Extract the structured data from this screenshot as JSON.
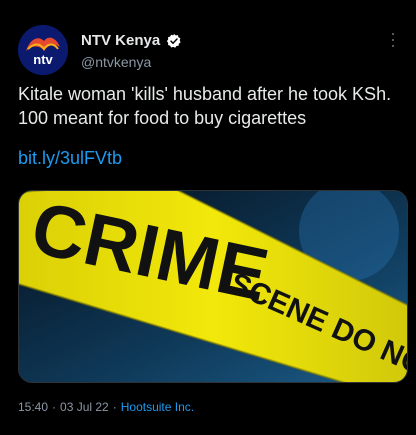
{
  "tweet": {
    "display_name": "NTV Kenya",
    "handle": "@ntvkenya",
    "avatar_text": "ntv",
    "text": "Kitale woman 'kills' husband after he took KSh. 100 meant for food to buy cigarettes",
    "link": "bit.ly/3ulFVtb",
    "media": {
      "tape_text_1": "CRIME",
      "tape_text_2": "SCENE DO NOT CROSS"
    },
    "time": "15:40",
    "separator_1": "·",
    "date": "03 Jul 22",
    "separator_2": "·",
    "source": "Hootsuite Inc."
  },
  "colors": {
    "background": "#000000",
    "accent": "#1d9bf0",
    "verified_badge": "#ffffff",
    "tape": "#f2e80a"
  },
  "icons": {
    "verified": "verified-badge-icon",
    "more": "more-options-icon"
  }
}
